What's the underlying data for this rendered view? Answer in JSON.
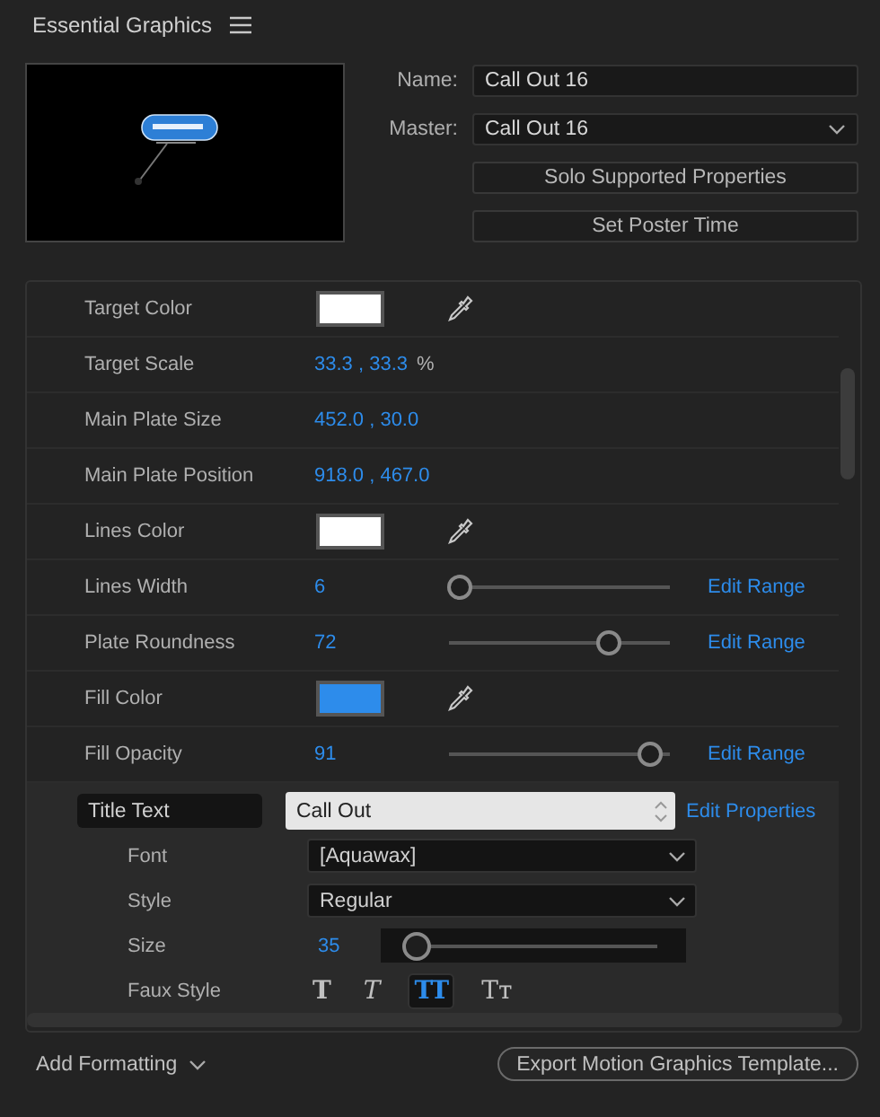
{
  "panel": {
    "title": "Essential Graphics"
  },
  "name_field": {
    "label": "Name:",
    "value": "Call Out 16"
  },
  "master_field": {
    "label": "Master:",
    "value": "Call Out 16"
  },
  "buttons": [
    "Solo Supported Properties",
    "Set Poster Time"
  ],
  "properties": [
    {
      "kind": "color",
      "label": "Target Color",
      "color": "#ffffff"
    },
    {
      "kind": "pair",
      "label": "Target Scale",
      "value": "33.3 , 33.3",
      "unit": "%"
    },
    {
      "kind": "pair",
      "label": "Main Plate Size",
      "value": "452.0 , 30.0"
    },
    {
      "kind": "pair",
      "label": "Main Plate Position",
      "value": "918.0 , 467.0"
    },
    {
      "kind": "color",
      "label": "Lines Color",
      "color": "#ffffff"
    },
    {
      "kind": "slider",
      "label": "Lines Width",
      "value": "6",
      "level": 0.05,
      "link": "Edit Range"
    },
    {
      "kind": "slider",
      "label": "Plate Roundness",
      "value": "72",
      "level": 0.72,
      "link": "Edit Range"
    },
    {
      "kind": "color",
      "label": "Fill Color",
      "color": "#2d8ceb"
    },
    {
      "kind": "slider",
      "label": "Fill Opacity",
      "value": "91",
      "level": 0.91,
      "link": "Edit Range"
    }
  ],
  "title_text": {
    "label": "Title Text",
    "value": "Call Out",
    "link": "Edit Properties",
    "font": {
      "label": "Font",
      "value": "[Aquawax]"
    },
    "style": {
      "label": "Style",
      "value": "Regular"
    },
    "size": {
      "label": "Size",
      "value": "35",
      "level": 0.04
    },
    "faux_style": {
      "label": "Faux Style",
      "options": [
        {
          "kind": "bold",
          "glyph": "T",
          "selected": false
        },
        {
          "kind": "italic",
          "glyph": "T",
          "selected": false
        },
        {
          "kind": "caps",
          "glyph": "TT",
          "selected": true
        },
        {
          "kind": "smallcaps",
          "glyph": "Tт",
          "selected": false
        }
      ]
    }
  },
  "footer": {
    "add_formatting": "Add Formatting",
    "export_button": "Export Motion Graphics Template..."
  }
}
